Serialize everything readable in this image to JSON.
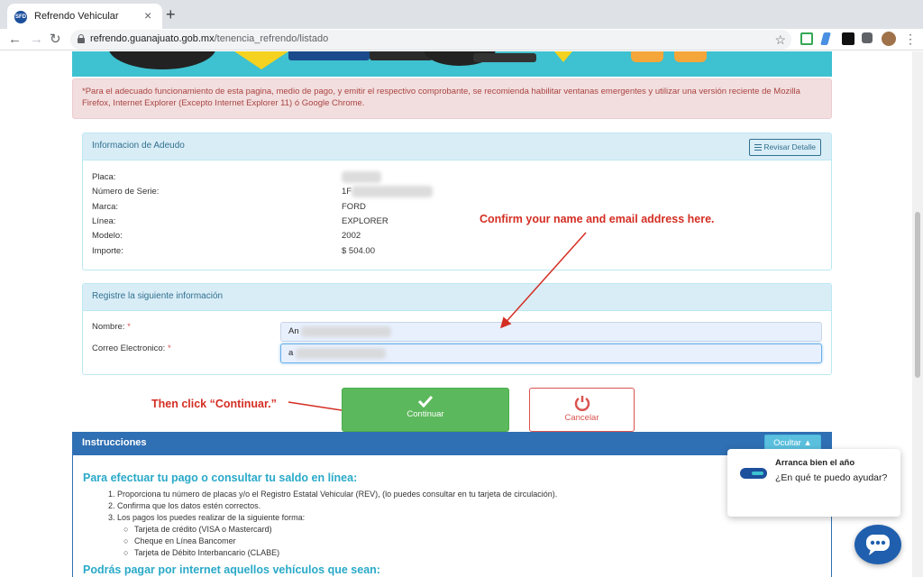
{
  "browser": {
    "tab_title": "Refrendo Vehicular",
    "tab_favicon_text": "SFD",
    "url_host": "refrendo.guanajuato.gob.mx",
    "url_path": "/tenencia_refrendo/listado"
  },
  "alert": {
    "text": "*Para el adecuado funcionamiento de esta pagina, medio de pago, y emitir el respectivo comprobante, se recomienda habilitar ventanas emergentes y utilizar una versión reciente de Mozilla Firefox, Internet Explorer (Excepto Internet Explorer 11) ó Google Chrome."
  },
  "debt_panel": {
    "heading": "Informacion de Adeudo",
    "detail_button": "Revisar Detalle",
    "rows": [
      {
        "label": "Placa:",
        "value": ""
      },
      {
        "label": "Número de Serie:",
        "value": "1F"
      },
      {
        "label": "Marca:",
        "value": "FORD"
      },
      {
        "label": "Línea:",
        "value": "EXPLORER"
      },
      {
        "label": "Modelo:",
        "value": "2002"
      },
      {
        "label": "Importe:",
        "value": "$ 504.00"
      }
    ]
  },
  "register_panel": {
    "heading": "Registre la siguiente información",
    "name_label": "Nombre:",
    "email_label": "Correo Electronico:",
    "required_mark": "*",
    "name_value": "An",
    "email_value": "a"
  },
  "buttons": {
    "continue": "Continuar",
    "cancel": "Cancelar"
  },
  "annotations": {
    "confirm": "Confirm your name and email address here.",
    "click": "Then click “Continuar.”"
  },
  "instructions": {
    "bar_title": "Instrucciones",
    "hide_button": "Ocultar",
    "heading_1": "Para efectuar tu pago o consultar tu saldo en línea:",
    "steps": [
      "1. Proporciona tu número de placas y/o el Registro Estatal Vehicular (REV), (lo puedes consultar en tu tarjeta de circulación).",
      "2. Confirma que los datos estén correctos.",
      "3. Los pagos los puedes realizar de la siguiente forma:"
    ],
    "payment_methods": [
      "Tarjeta de crédito (VISA o Mastercard)",
      "Cheque en Línea Bancomer",
      "Tarjeta de Débito Interbancario (CLABE)"
    ],
    "heading_2": "Podrás pagar por internet aquellos vehículos que sean:"
  },
  "chat": {
    "title": "Arranca bien el año",
    "message": "¿En qué te puedo ayudar?"
  },
  "colors": {
    "accent_blue": "#2f6fb3",
    "success_green": "#5cb85c",
    "danger_red": "#d9534f",
    "annotation_red": "#d42e23",
    "banner_teal": "#3ec1d0"
  }
}
